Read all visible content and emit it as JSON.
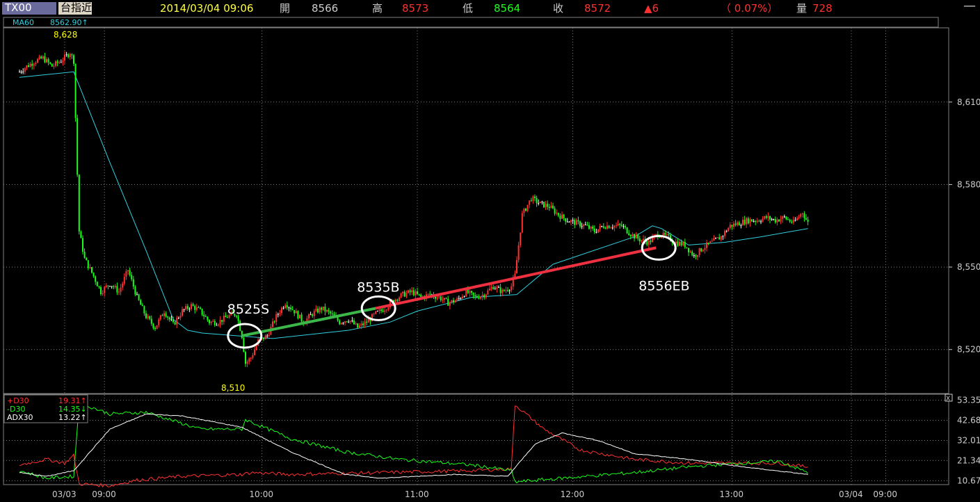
{
  "header": {
    "symbol": "TX00",
    "board": "台指近",
    "datetime": "2014/03/04 09:06",
    "open_label": "開",
    "open_value": "8566",
    "high_label": "高",
    "high_value": "8573",
    "low_label": "低",
    "low_value": "8564",
    "close_label": "收",
    "close_value": "8572",
    "change": "▲6",
    "change_pct": "（ 0.07%）",
    "volume_label": "量",
    "volume_value": "728",
    "minimize": "—"
  },
  "colors": {
    "up": "#ff3030",
    "down": "#19ff19",
    "ma": "#30d0e0",
    "flat": "#ffffff",
    "grid": "#808080",
    "label_high": "#ffff00",
    "trade_short": "#3cb84a",
    "trade_long": "#ee3040"
  },
  "chart_data": [
    {
      "type": "candlestick",
      "title": "",
      "ma_label": "MA60",
      "ma_value": "8562.90↑",
      "ylim": [
        8504,
        8637
      ],
      "y_ticks": [
        8520,
        8550,
        8580,
        8610
      ],
      "y_tick_labels": [
        "8,520",
        "8,550",
        "8,580",
        "8,610"
      ],
      "x_tick_labels": [
        "03/03",
        "09:00",
        "10:00",
        "11:00",
        "12:00",
        "13:00",
        "03/04",
        "09:00"
      ],
      "high_label": "8,628",
      "low_label": "8,510",
      "price_path": [
        [
          0,
          8621
        ],
        [
          4,
          8623
        ],
        [
          9,
          8625
        ],
        [
          13,
          8626
        ],
        [
          18,
          8623
        ],
        [
          23,
          8625
        ],
        [
          28,
          8628
        ],
        [
          30,
          8625
        ],
        [
          33,
          8563
        ],
        [
          36,
          8553
        ],
        [
          40,
          8548
        ],
        [
          45,
          8541
        ],
        [
          50,
          8544
        ],
        [
          55,
          8541
        ],
        [
          60,
          8549
        ],
        [
          65,
          8539
        ],
        [
          70,
          8532
        ],
        [
          75,
          8528
        ],
        [
          80,
          8534
        ],
        [
          85,
          8529
        ],
        [
          90,
          8534
        ],
        [
          95,
          8536
        ],
        [
          100,
          8534
        ],
        [
          105,
          8530
        ],
        [
          110,
          8530
        ],
        [
          115,
          8532
        ],
        [
          120,
          8533
        ],
        [
          123,
          8525
        ],
        [
          125,
          8515
        ],
        [
          128,
          8517
        ],
        [
          132,
          8523
        ],
        [
          137,
          8525
        ],
        [
          142,
          8532
        ],
        [
          147,
          8537
        ],
        [
          152,
          8534
        ],
        [
          157,
          8530
        ],
        [
          162,
          8533
        ],
        [
          167,
          8535
        ],
        [
          172,
          8533
        ],
        [
          177,
          8530
        ],
        [
          182,
          8531
        ],
        [
          187,
          8528
        ],
        [
          192,
          8530
        ],
        [
          197,
          8533
        ],
        [
          202,
          8535
        ],
        [
          207,
          8538
        ],
        [
          212,
          8540
        ],
        [
          217,
          8541
        ],
        [
          222,
          8539
        ],
        [
          227,
          8540
        ],
        [
          232,
          8539
        ],
        [
          237,
          8537
        ],
        [
          242,
          8538
        ],
        [
          247,
          8541
        ],
        [
          252,
          8539
        ],
        [
          257,
          8540
        ],
        [
          262,
          8543
        ],
        [
          267,
          8541
        ],
        [
          272,
          8543
        ],
        [
          274,
          8547
        ],
        [
          278,
          8569
        ],
        [
          283,
          8575
        ],
        [
          288,
          8573
        ],
        [
          293,
          8572
        ],
        [
          298,
          8569
        ],
        [
          303,
          8567
        ],
        [
          308,
          8566
        ],
        [
          313,
          8565
        ],
        [
          318,
          8563
        ],
        [
          323,
          8565
        ],
        [
          328,
          8565
        ],
        [
          333,
          8565
        ],
        [
          338,
          8562
        ],
        [
          343,
          8560
        ],
        [
          348,
          8559
        ],
        [
          353,
          8562
        ],
        [
          358,
          8561
        ],
        [
          363,
          8559
        ],
        [
          368,
          8558
        ],
        [
          373,
          8554
        ],
        [
          378,
          8557
        ],
        [
          383,
          8559
        ],
        [
          388,
          8561
        ],
        [
          393,
          8565
        ],
        [
          398,
          8566
        ],
        [
          403,
          8567
        ],
        [
          408,
          8567
        ],
        [
          413,
          8568
        ],
        [
          418,
          8567
        ],
        [
          423,
          8568
        ],
        [
          428,
          8566
        ],
        [
          433,
          8570
        ],
        [
          436,
          8566
        ]
      ],
      "ma60_path": [
        [
          0,
          8619
        ],
        [
          30,
          8621
        ],
        [
          50,
          8588
        ],
        [
          70,
          8556
        ],
        [
          85,
          8531
        ],
        [
          93,
          8527
        ],
        [
          101,
          8526
        ],
        [
          140,
          8524
        ],
        [
          182,
          8527
        ],
        [
          205,
          8530
        ],
        [
          220,
          8534
        ],
        [
          250,
          8539
        ],
        [
          275,
          8540
        ],
        [
          295,
          8551
        ],
        [
          340,
          8561
        ],
        [
          350,
          8565
        ],
        [
          355,
          8564
        ],
        [
          370,
          8558
        ],
        [
          390,
          8559
        ],
        [
          410,
          8561
        ],
        [
          436,
          8564
        ]
      ],
      "trades": [
        {
          "label": "8525S",
          "bar": 123,
          "price": 8525,
          "side": "short"
        },
        {
          "label": "8535B",
          "bar": 197,
          "price": 8535,
          "side": "long"
        },
        {
          "label": "8556EB",
          "bar": 352,
          "price": 8557,
          "side": "exit"
        }
      ]
    },
    {
      "type": "line",
      "title": "",
      "ylim": [
        8.6,
        56.5
      ],
      "y_ticks": [
        10.67,
        21.34,
        32.01,
        42.68,
        53.35
      ],
      "y_tick_labels": [
        "10.67",
        "21.34",
        "32.01",
        "42.68",
        "53.35"
      ],
      "close_icon": "X",
      "series": [
        {
          "name": "+D30",
          "value": "19.31↑",
          "color": "#ff3030",
          "path": [
            [
              0,
              19
            ],
            [
              15,
              22
            ],
            [
              25,
              20
            ],
            [
              30,
              24
            ],
            [
              33,
              9
            ],
            [
              50,
              8
            ],
            [
              65,
              11
            ],
            [
              90,
              13
            ],
            [
              123,
              14
            ],
            [
              128,
              15
            ],
            [
              150,
              14
            ],
            [
              200,
              15
            ],
            [
              250,
              16
            ],
            [
              272,
              17
            ],
            [
              274,
              51
            ],
            [
              290,
              38
            ],
            [
              310,
              27
            ],
            [
              340,
              22
            ],
            [
              370,
              20
            ],
            [
              400,
              20
            ],
            [
              420,
              20
            ],
            [
              436,
              18
            ]
          ]
        },
        {
          "name": "-D30",
          "value": "14.35↓",
          "color": "#19ff19",
          "path": [
            [
              0,
              16
            ],
            [
              15,
              12
            ],
            [
              30,
              13
            ],
            [
              33,
              52
            ],
            [
              50,
              46
            ],
            [
              70,
              47
            ],
            [
              100,
              38
            ],
            [
              123,
              38
            ],
            [
              125,
              43
            ],
            [
              150,
              33
            ],
            [
              180,
              26
            ],
            [
              210,
              22
            ],
            [
              250,
              19
            ],
            [
              272,
              16
            ],
            [
              274,
              10
            ],
            [
              300,
              12
            ],
            [
              340,
              15
            ],
            [
              370,
              18
            ],
            [
              400,
              20
            ],
            [
              420,
              21
            ],
            [
              436,
              15
            ]
          ]
        },
        {
          "name": "ADX30",
          "value": "13.22↑",
          "color": "#ffffff",
          "path": [
            [
              0,
              15
            ],
            [
              15,
              13
            ],
            [
              30,
              16
            ],
            [
              50,
              38
            ],
            [
              70,
              46
            ],
            [
              90,
              45
            ],
            [
              123,
              39
            ],
            [
              150,
              26
            ],
            [
              180,
              14
            ],
            [
              200,
              12
            ],
            [
              240,
              14
            ],
            [
              270,
              13
            ],
            [
              285,
              30
            ],
            [
              300,
              36
            ],
            [
              320,
              32
            ],
            [
              340,
              25
            ],
            [
              370,
              22
            ],
            [
              400,
              18
            ],
            [
              436,
              14
            ]
          ]
        }
      ]
    }
  ]
}
